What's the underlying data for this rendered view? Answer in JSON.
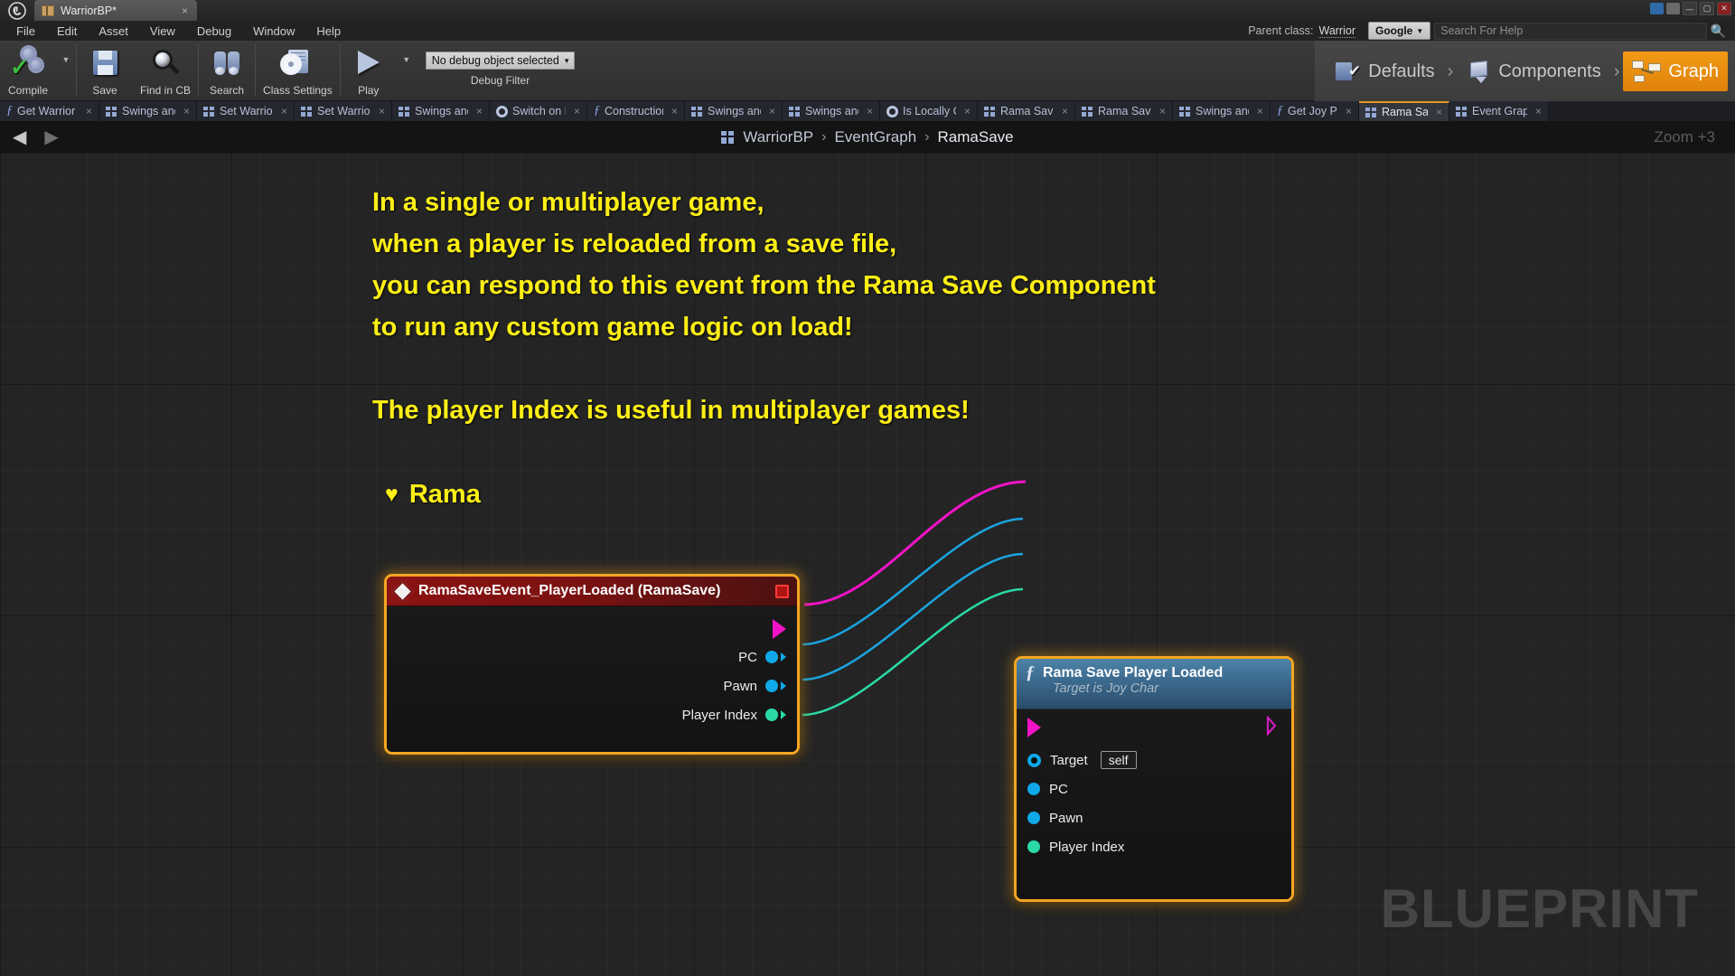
{
  "window": {
    "app_icon": "unreal-logo-icon",
    "tab_title": "WarriorBP*",
    "tab_close": "×",
    "controls": [
      "minimize",
      "maximize",
      "close"
    ]
  },
  "menubar": {
    "items": [
      "File",
      "Edit",
      "Asset",
      "View",
      "Debug",
      "Window",
      "Help"
    ]
  },
  "parent_class": {
    "label": "Parent class:",
    "value": "Warrior"
  },
  "help": {
    "engine_label": "Google",
    "search_placeholder": "Search For Help",
    "search_value": ""
  },
  "toolbar": {
    "buttons": [
      {
        "label": "Compile",
        "icon": "compile-gear-check-icon",
        "has_dropdown": true
      },
      {
        "label": "Save",
        "icon": "floppy-disk-icon",
        "has_dropdown": false
      },
      {
        "label": "Find in CB",
        "icon": "magnifier-icon",
        "has_dropdown": false
      },
      {
        "label": "Search",
        "icon": "binoculars-icon",
        "has_dropdown": false
      },
      {
        "label": "Class Settings",
        "icon": "class-settings-icon",
        "has_dropdown": false
      },
      {
        "label": "Play",
        "icon": "play-triangle-icon",
        "has_dropdown": true
      }
    ],
    "debug": {
      "selector_value": "No debug object selected",
      "caret": "▾",
      "label": "Debug Filter"
    }
  },
  "modes": {
    "items": [
      {
        "label": "Defaults",
        "icon": "defaults-icon",
        "active": false
      },
      {
        "label": "Components",
        "icon": "components-cube-icon",
        "active": false
      },
      {
        "label": "Graph",
        "icon": "graph-nodes-icon",
        "active": true
      }
    ],
    "separator": "›",
    "active_color": "#ef9312"
  },
  "graph_tabs": [
    {
      "label": "Get Warrior A",
      "icon": "function-icon",
      "active": false
    },
    {
      "label": "Swings and F",
      "icon": "macro-grid-icon",
      "active": false
    },
    {
      "label": "Set Warrior St",
      "icon": "macro-grid-icon",
      "active": false
    },
    {
      "label": "Set Warrior St",
      "icon": "macro-grid-icon",
      "active": false
    },
    {
      "label": "Swings and F",
      "icon": "macro-grid-icon",
      "active": false
    },
    {
      "label": "Switch on Is A",
      "icon": "gear-icon",
      "active": false
    },
    {
      "label": "Construction",
      "icon": "function-icon",
      "active": false
    },
    {
      "label": "Swings and F",
      "icon": "macro-grid-icon",
      "active": false
    },
    {
      "label": "Swings and F",
      "icon": "macro-grid-icon",
      "active": false
    },
    {
      "label": "Is Locally Cor",
      "icon": "gear-icon",
      "active": false
    },
    {
      "label": "Rama Save",
      "icon": "macro-grid-icon",
      "active": false
    },
    {
      "label": "Rama Save",
      "icon": "macro-grid-icon",
      "active": false
    },
    {
      "label": "Swings and F",
      "icon": "macro-grid-icon",
      "active": false
    },
    {
      "label": "Get Joy PC",
      "icon": "function-icon",
      "active": false
    },
    {
      "label": "Rama Save",
      "icon": "macro-grid-icon",
      "active": true
    },
    {
      "label": "Event Graph",
      "icon": "macro-grid-icon",
      "active": false
    }
  ],
  "breadcrumb": {
    "back_arrow": "◀",
    "forward_arrow": "▶",
    "icon": "blueprint-grid-icon",
    "items": [
      "WarriorBP",
      "EventGraph",
      "RamaSave"
    ],
    "separator": "›",
    "zoom_label": "Zoom +3"
  },
  "canvas": {
    "comment": "In a single or multiplayer game,\nwhen a player is reloaded from a save file,\nyou can respond to this event from the Rama Save Component\nto run any custom game logic on load!\n\nThe player Index is useful in multiplayer games!",
    "signature_heart": "♥",
    "signature_name": "Rama",
    "comment_color": "#ffef16",
    "watermark": "BLUEPRINT"
  },
  "nodes": {
    "event_node": {
      "title": "RamaSaveEvent_PlayerLoaded (RamaSave)",
      "icon": "event-diamond-icon",
      "delegate_pin": "delegate-output-pin",
      "exec_out": "exec-output-pin",
      "outputs": [
        {
          "label": "PC",
          "type": "object",
          "color": "#0fa8e8"
        },
        {
          "label": "Pawn",
          "type": "object",
          "color": "#0fa8e8"
        },
        {
          "label": "Player Index",
          "type": "integer",
          "color": "#29d9a6"
        }
      ],
      "header_color": "#8b1313",
      "selected": true
    },
    "function_node": {
      "title": "Rama Save Player Loaded",
      "subtitle": "Target is Joy Char",
      "icon": "function-f-icon",
      "exec_in": "exec-input-pin",
      "exec_out": "exec-output-pin",
      "inputs": [
        {
          "label": "Target",
          "value": "self",
          "type": "object-ref",
          "color": "#0fa8e8"
        },
        {
          "label": "PC",
          "value": "",
          "type": "object",
          "color": "#0fa8e8"
        },
        {
          "label": "Pawn",
          "value": "",
          "type": "object",
          "color": "#0fa8e8"
        },
        {
          "label": "Player Index",
          "value": "",
          "type": "integer",
          "color": "#29d9a6"
        }
      ],
      "header_color": "#3d6c90",
      "selected": true
    }
  }
}
